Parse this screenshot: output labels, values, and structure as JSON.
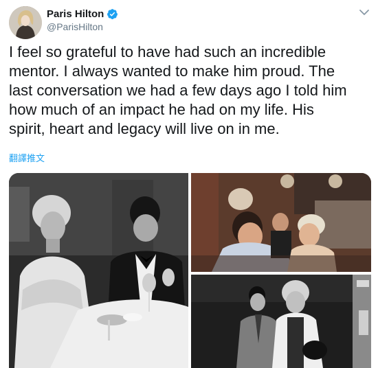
{
  "tweet": {
    "author": {
      "display_name": "Paris Hilton",
      "handle": "@ParisHilton",
      "verified": true,
      "avatar_icon": "profile-photo"
    },
    "menu_icon": "chevron-down-icon",
    "text": "I feel so grateful to have had such an incredible\nmentor. I always wanted to make him proud. The\nlast conversation we had a few days ago I told him\nhow much of an impact he had on my life. His\nspirit, heart and legacy will live on in me.",
    "translate_label": "翻譯推文",
    "media": [
      {
        "kind": "photo",
        "description_icon": "black-and-white-photo"
      },
      {
        "kind": "photo",
        "description_icon": "color-photo"
      },
      {
        "kind": "photo",
        "description_icon": "black-and-white-photo"
      }
    ],
    "colors": {
      "link": "#1da1f2",
      "verified": "#1da1f2",
      "secondary_text": "#657786"
    }
  }
}
